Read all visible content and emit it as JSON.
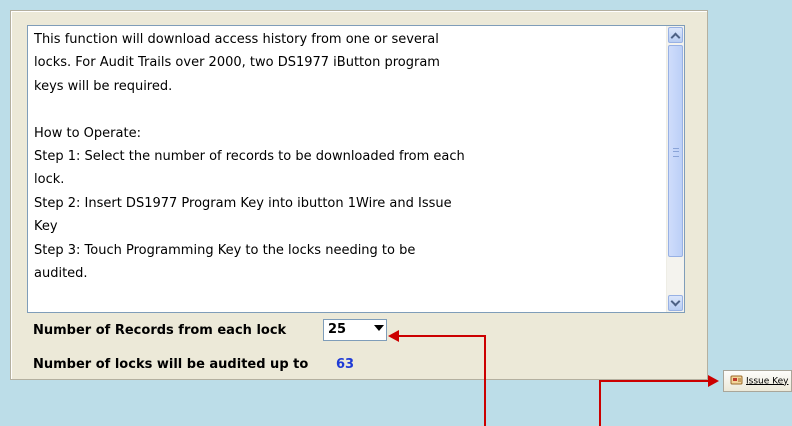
{
  "instructions": {
    "lines": [
      "This function will download access history from one or several",
      "locks.  For Audit Trails over 2000, two DS1977 iButton program",
      "keys will be required.",
      "",
      "How to Operate:",
      "Step 1: Select the number of records to be downloaded from each",
      "lock.",
      "Step 2: Insert DS1977 Program Key into ibutton 1Wire and Issue",
      "Key",
      "Step 3: Touch Programming Key to the locks needing to be",
      "audited."
    ]
  },
  "records": {
    "label": "Number of Records from each lock",
    "value": "25"
  },
  "locks": {
    "label": "Number of locks will be audited up to",
    "value": "63"
  },
  "issue_key": {
    "label": "Issue Key"
  },
  "colors": {
    "background": "#bcdde8",
    "panel": "#ece9d8",
    "count_text": "#1f3bd6",
    "callout_arrow": "#cc0000"
  }
}
